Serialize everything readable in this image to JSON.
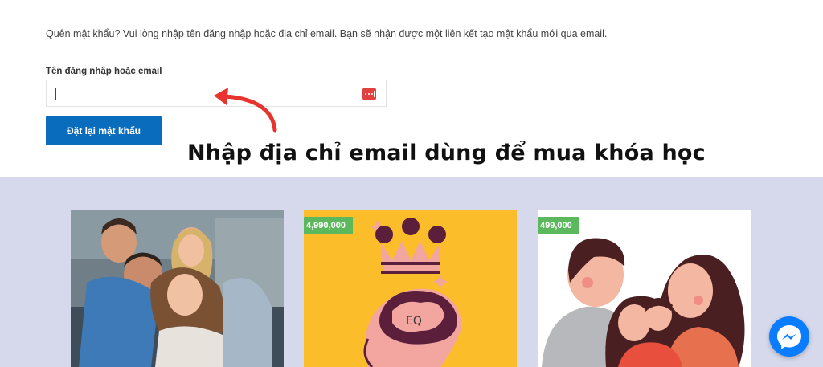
{
  "intro_text": "Quên mật khẩu? Vui lòng nhập tên đăng nhập hoặc địa chỉ email. Bạn sẽ nhận được một liên kết tạo mật khẩu mới qua email.",
  "form": {
    "field_label": "Tên đăng nhập hoặc email",
    "field_value": "",
    "submit_label": "Đặt lại mật khẩu"
  },
  "annotation": "Nhập địa chỉ email dùng để mua khóa học",
  "courses": [
    {
      "price": ""
    },
    {
      "price": "4,990,000",
      "badge_text": "EQ"
    },
    {
      "price": "499,000"
    }
  ],
  "colors": {
    "primary_button": "#0a6cbc",
    "price_badge": "#5cb85c",
    "section_bg": "#d5d9eb",
    "arrow": "#e8332e",
    "messenger": "#0a7cff"
  },
  "icons": {
    "password_manager": "password-manager-icon",
    "messenger": "messenger-icon"
  }
}
